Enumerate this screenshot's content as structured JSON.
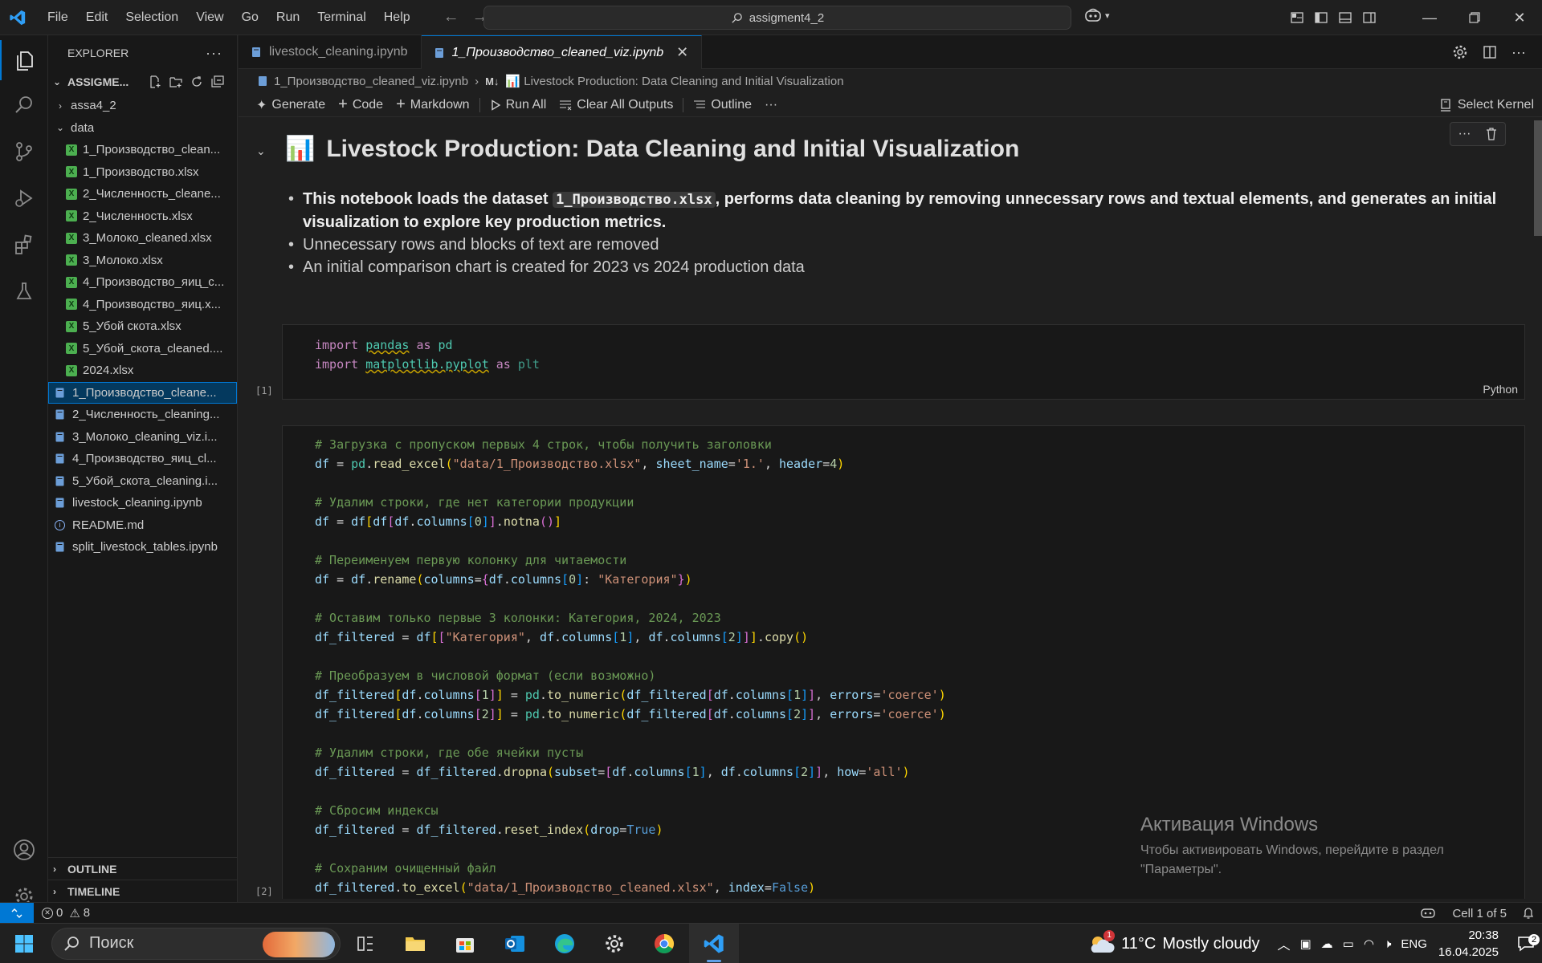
{
  "app": {
    "accent": "#0078d4"
  },
  "menu": [
    "File",
    "Edit",
    "Selection",
    "View",
    "Go",
    "Run",
    "Terminal",
    "Help"
  ],
  "command_center": {
    "text": "assigment4_2"
  },
  "explorer": {
    "title": "EXPLORER",
    "root": "ASSIGME...",
    "items": [
      {
        "label": "assa4_2",
        "kind": "folder-collapsed",
        "depth": 1
      },
      {
        "label": "data",
        "kind": "folder-open",
        "depth": 1
      },
      {
        "label": "1_Производство_clean...",
        "kind": "xlsx",
        "depth": 2
      },
      {
        "label": "1_Производство.xlsx",
        "kind": "xlsx",
        "depth": 2
      },
      {
        "label": "2_Численность_cleane...",
        "kind": "xlsx",
        "depth": 2
      },
      {
        "label": "2_Численность.xlsx",
        "kind": "xlsx",
        "depth": 2
      },
      {
        "label": "3_Молоко_cleaned.xlsx",
        "kind": "xlsx",
        "depth": 2
      },
      {
        "label": "3_Молоко.xlsx",
        "kind": "xlsx",
        "depth": 2
      },
      {
        "label": "4_Производство_яиц_c...",
        "kind": "xlsx",
        "depth": 2
      },
      {
        "label": "4_Производство_яиц.x...",
        "kind": "xlsx",
        "depth": 2
      },
      {
        "label": "5_Убой скота.xlsx",
        "kind": "xlsx",
        "depth": 2
      },
      {
        "label": "5_Убой_скота_cleaned....",
        "kind": "xlsx",
        "depth": 2
      },
      {
        "label": "2024.xlsx",
        "kind": "xlsx",
        "depth": 2
      },
      {
        "label": "1_Производство_cleane...",
        "kind": "ipynb",
        "depth": 1,
        "selected": true
      },
      {
        "label": "2_Численность_cleaning...",
        "kind": "ipynb",
        "depth": 1
      },
      {
        "label": "3_Молоко_cleaning_viz.i...",
        "kind": "ipynb",
        "depth": 1
      },
      {
        "label": "4_Производство_яиц_cl...",
        "kind": "ipynb",
        "depth": 1
      },
      {
        "label": "5_Убой_скота_cleaning.i...",
        "kind": "ipynb",
        "depth": 1
      },
      {
        "label": "livestock_cleaning.ipynb",
        "kind": "ipynb",
        "depth": 1
      },
      {
        "label": "README.md",
        "kind": "info",
        "depth": 1
      },
      {
        "label": "split_livestock_tables.ipynb",
        "kind": "ipynb",
        "depth": 1
      }
    ],
    "outline": "OUTLINE",
    "timeline": "TIMELINE"
  },
  "tabs": [
    {
      "label": "livestock_cleaning.ipynb",
      "active": false
    },
    {
      "label": "1_Производство_cleaned_viz.ipynb",
      "active": true
    }
  ],
  "breadcrumb": {
    "file": "1_Производство_cleaned_viz.ipynb",
    "md_badge": "M↓",
    "section": "📊 Livestock Production: Data Cleaning and Initial Visualization"
  },
  "toolbar": {
    "generate": "Generate",
    "code": "Code",
    "markdown": "Markdown",
    "run_all": "Run All",
    "clear_outputs": "Clear All Outputs",
    "outline": "Outline",
    "more": "···",
    "kernel": "Select Kernel"
  },
  "markdown_cell": {
    "emoji": "📊",
    "title": "Livestock Production: Data Cleaning and Initial Visualization",
    "bullet1_pre": "This notebook loads the dataset ",
    "bullet1_code": "1_Производство.xlsx",
    "bullet1_post": ", performs data cleaning by removing unnecessary rows and textual elements, and generates an initial visualization to explore key production metrics.",
    "bullet2": "Unnecessary rows and blocks of text are removed",
    "bullet3": "An initial comparison chart is created for 2023 vs 2024 production data"
  },
  "cell1": {
    "exec": "[1]",
    "language": "Python"
  },
  "cell2": {
    "exec": "[2]",
    "c1": "# Загрузка с пропуском первых 4 строк, чтобы получить заголовки",
    "c2": "# Удалим строки, где нет категории продукции",
    "c3": "# Переименуем первую колонку для читаемости",
    "c4": "# Оставим только первые 3 колонки: Категория, 2024, 2023",
    "c5": "# Преобразуем в числовой формат (если возможно)",
    "c6": "# Удалим строки, где обе ячейки пусты",
    "c7": "# Сбросим индексы",
    "c8": "# Сохраним очищенный файл"
  },
  "watermark": {
    "title": "Активация Windows",
    "line1": "Чтобы активировать Windows, перейдите в раздел",
    "line2": "\"Параметры\"."
  },
  "statusbar": {
    "errors": "0",
    "warnings": "8",
    "cell": "Cell 1 of 5"
  },
  "taskbar": {
    "search": "Поиск",
    "weather_temp": "11°C",
    "weather_text": "Mostly cloudy",
    "weather_badge": "1",
    "lang": "ENG",
    "time": "20:38",
    "date": "16.04.2025",
    "notif_count": "2"
  }
}
